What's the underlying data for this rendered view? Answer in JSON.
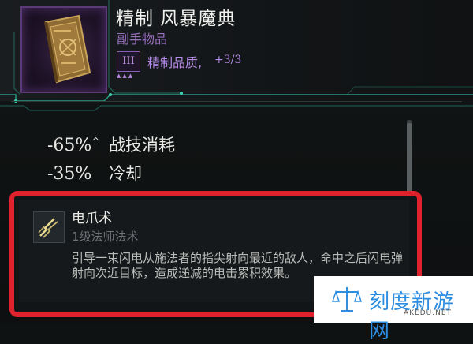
{
  "item": {
    "name": "精制 风暴魔典",
    "type": "副手物品",
    "tier": "III",
    "tier_pips": "▲▲▲",
    "quality_label": "精制品质,",
    "quality_value": "+3/3",
    "icon": "grimoire-book-icon"
  },
  "stats": [
    {
      "value": "-65%",
      "caret": "^",
      "label": "战技消耗"
    },
    {
      "value": "-35%",
      "caret": "",
      "label": "冷却"
    }
  ],
  "spell": {
    "icon": "lightning-claw-icon",
    "name": "电爪术",
    "type": "1级法师法术",
    "description": "引导一束闪电从施法者的指尖射向最近的敌人，命中之后闪电弹射向次近目标，造成递减的电击累积效果。"
  },
  "watermark": {
    "name": "刻度新游网",
    "domain": "AKEDU.NET"
  },
  "colors": {
    "highlight_border": "#e0222c",
    "quality_purple": "#b68ae6",
    "frame_green": "#2fb89a",
    "watermark_blue": "#2f8de0"
  }
}
